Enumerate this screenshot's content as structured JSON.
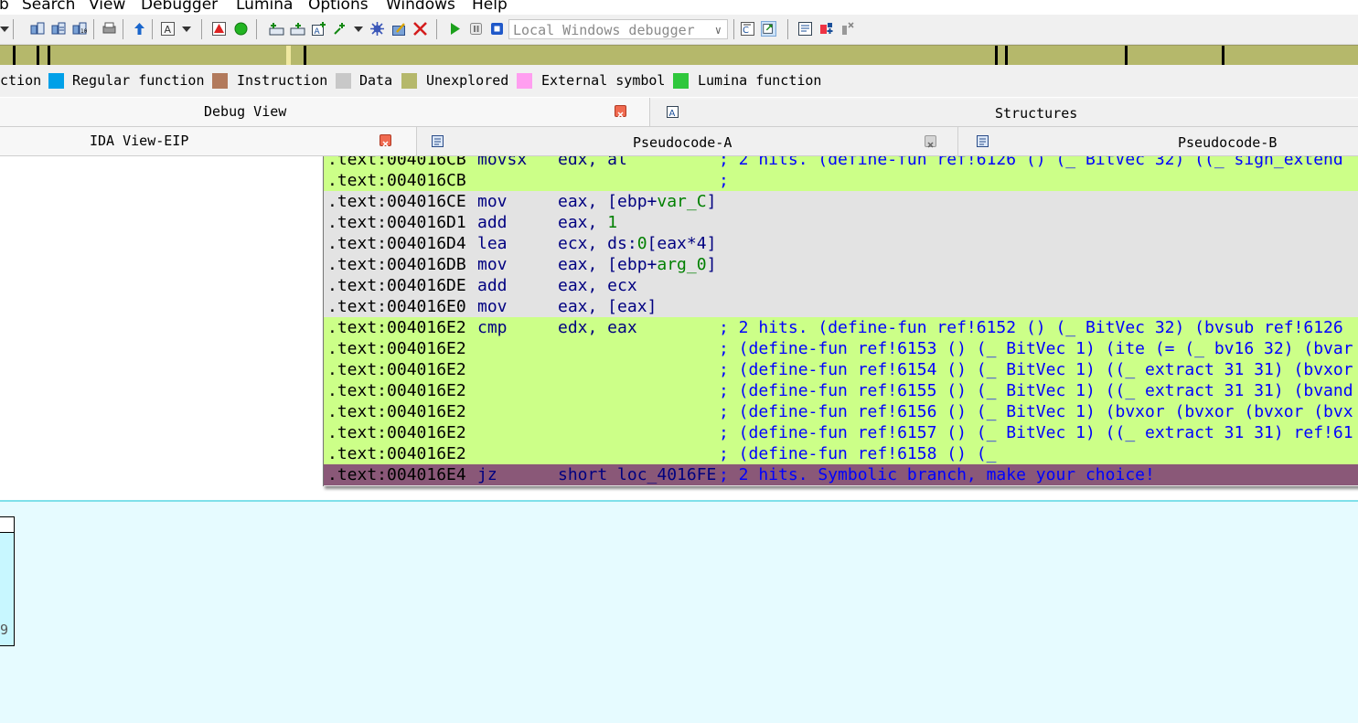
{
  "menu": [
    "b",
    "Search",
    "View",
    "Debugger",
    "Lumina",
    "Options",
    "Windows",
    "Help"
  ],
  "debugger_select": {
    "value": "Local Windows debugger"
  },
  "toolbar_icons": [
    "segment-icon",
    "segment-edit-icon",
    "segment-list-icon",
    "print-icon",
    "jump-up-icon",
    "text-mode-icon",
    "stop-icon",
    "run-icon",
    "add-icon",
    "add-list-icon",
    "add-text-icon",
    "add-struct-icon",
    "settings-icon",
    "edit-icon",
    "close-icon",
    "play-icon",
    "pause-icon",
    "stop-square-icon",
    "step-into-icon",
    "step-over-icon",
    "chart-icon",
    "plugin-icon",
    "disconnect-icon"
  ],
  "legend": [
    {
      "label": "ction",
      "color": null
    },
    {
      "label": "Regular function",
      "color": "#00a0e8"
    },
    {
      "label": "Instruction",
      "color": "#b27a5c"
    },
    {
      "label": "Data",
      "color": "#c8c8c8"
    },
    {
      "label": "Unexplored",
      "color": "#b5b86b"
    },
    {
      "label": "External symbol",
      "color": "#ff9ef0"
    },
    {
      "label": "Lumina function",
      "color": "#2fc73c"
    }
  ],
  "tabs": {
    "debug_view": "Debug View",
    "structures": "Structures",
    "ida_view": "IDA View-EIP",
    "pseudo_a": "Pseudocode-A",
    "pseudo_b": "Pseudocode-B"
  },
  "graph_node": {
    "label": "9"
  },
  "code_rows": [
    {
      "addr": ".text:004016CB",
      "mnem": "movsx",
      "ops": "edx, al",
      "comment": "; 2 hits. (define-fun ref!6126 () (_ BitVec 32) ((_ sign_extend"
    },
    {
      "addr": ".text:004016CB",
      "mnem": "",
      "ops": "",
      "comment": ";"
    },
    {
      "addr": ".text:004016CE",
      "mnem": "mov",
      "ops": "eax, [ebp+var_C]",
      "comment": ""
    },
    {
      "addr": ".text:004016D1",
      "mnem": "add",
      "ops": "eax, 1",
      "comment": ""
    },
    {
      "addr": ".text:004016D4",
      "mnem": "lea",
      "ops": "ecx, ds:0[eax*4]",
      "comment": ""
    },
    {
      "addr": ".text:004016DB",
      "mnem": "mov",
      "ops": "eax, [ebp+arg_0]",
      "comment": ""
    },
    {
      "addr": ".text:004016DE",
      "mnem": "add",
      "ops": "eax, ecx",
      "comment": ""
    },
    {
      "addr": ".text:004016E0",
      "mnem": "mov",
      "ops": "eax, [eax]",
      "comment": ""
    },
    {
      "addr": ".text:004016E2",
      "mnem": "cmp",
      "ops": "edx, eax",
      "comment": "; 2 hits. (define-fun ref!6152 () (_ BitVec 32) (bvsub ref!6126"
    },
    {
      "addr": ".text:004016E2",
      "mnem": "",
      "ops": "",
      "comment": "; (define-fun ref!6153 () (_ BitVec 1) (ite (= (_ bv16 32) (bvar"
    },
    {
      "addr": ".text:004016E2",
      "mnem": "",
      "ops": "",
      "comment": "; (define-fun ref!6154 () (_ BitVec 1) ((_ extract 31 31) (bvxor"
    },
    {
      "addr": ".text:004016E2",
      "mnem": "",
      "ops": "",
      "comment": "; (define-fun ref!6155 () (_ BitVec 1) ((_ extract 31 31) (bvand"
    },
    {
      "addr": ".text:004016E2",
      "mnem": "",
      "ops": "",
      "comment": "; (define-fun ref!6156 () (_ BitVec 1) (bvxor (bvxor (bvxor (bvx"
    },
    {
      "addr": ".text:004016E2",
      "mnem": "",
      "ops": "",
      "comment": "; (define-fun ref!6157 () (_ BitVec 1) ((_ extract 31 31) ref!61"
    },
    {
      "addr": ".text:004016E2",
      "mnem": "",
      "ops": "",
      "comment": "; (define-fun ref!6158 () (_"
    },
    {
      "addr": ".text:004016E4",
      "mnem": "jz",
      "ops": "short loc_4016FE",
      "comment": "; 2 hits. Symbolic branch, make your choice!"
    }
  ],
  "colors": {
    "hit_highlight": "#ccff88",
    "branch_highlight": "#8a5878",
    "unexplored": "#b5b86b"
  }
}
